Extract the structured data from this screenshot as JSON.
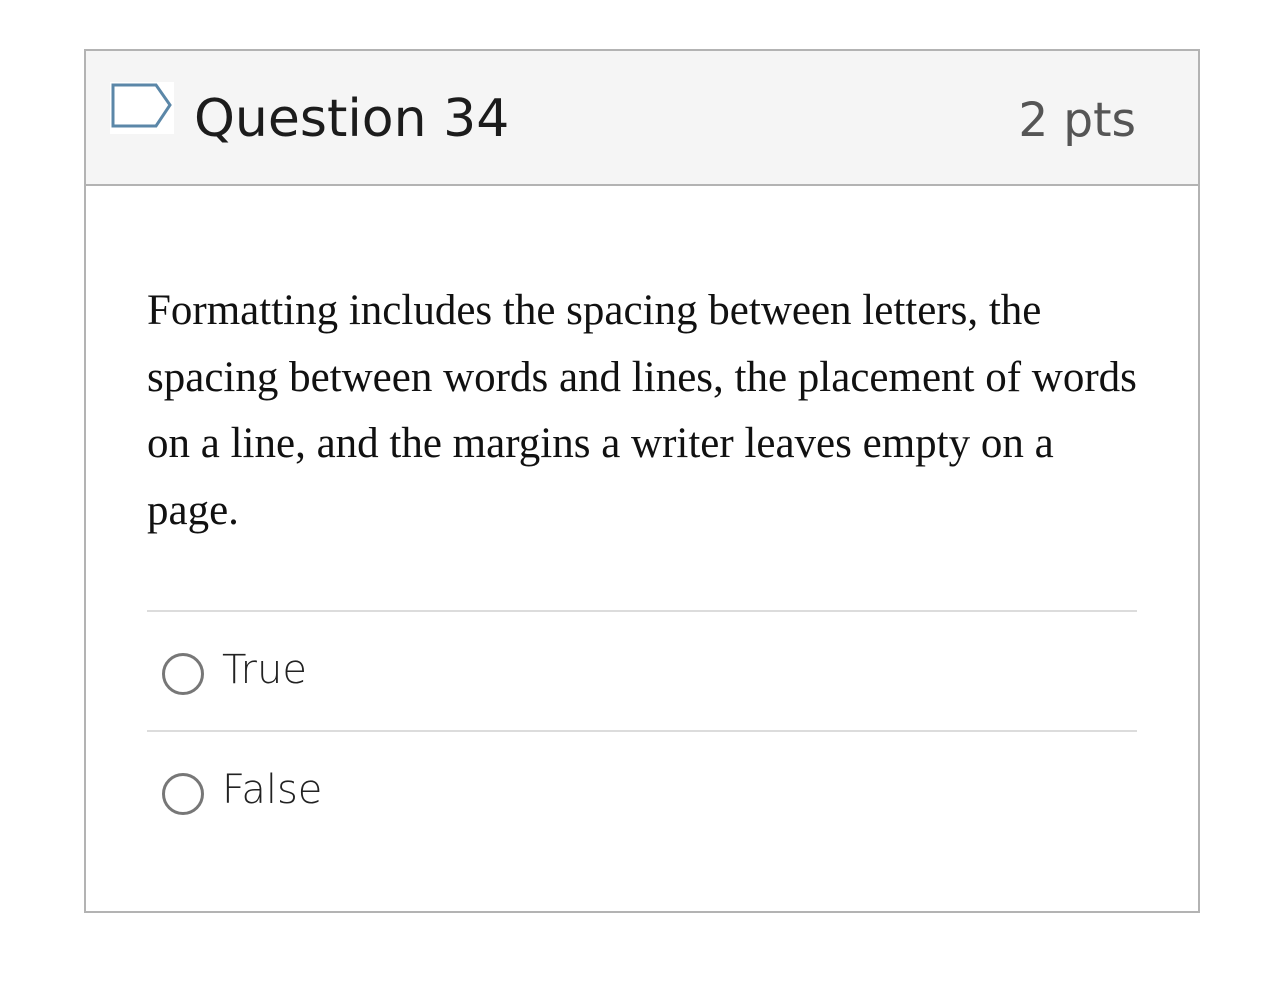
{
  "question": {
    "title": "Question 34",
    "points": "2 pts",
    "flag_icon": "flag-outline-icon",
    "text": "Formatting includes the spacing between letters, the spacing between words and lines, the placement of words on a line, and the margins a writer leaves empty on a page.",
    "answers": [
      {
        "label": "True",
        "selected": false
      },
      {
        "label": "False",
        "selected": false
      }
    ]
  },
  "colors": {
    "header_bg": "#f5f5f5",
    "border": "#b3b3b3",
    "flag_stroke": "#5b87a8"
  }
}
